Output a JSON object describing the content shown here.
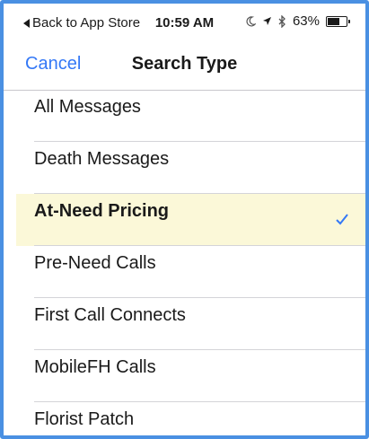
{
  "status_bar": {
    "back_label": "Back to App Store",
    "time": "10:59 AM",
    "battery_percent": "63%",
    "battery_level": 0.63
  },
  "nav": {
    "cancel_label": "Cancel",
    "title": "Search Type"
  },
  "colors": {
    "accent": "#3478f6",
    "selected_row_bg": "#fbf8d8",
    "frame_border": "#4a90e2"
  },
  "options": [
    {
      "label": "All Messages",
      "selected": false
    },
    {
      "label": "Death Messages",
      "selected": false
    },
    {
      "label": "At-Need Pricing",
      "selected": true
    },
    {
      "label": "Pre-Need Calls",
      "selected": false
    },
    {
      "label": "First Call Connects",
      "selected": false
    },
    {
      "label": "MobileFH Calls",
      "selected": false
    },
    {
      "label": "Florist Patch",
      "selected": false
    }
  ]
}
